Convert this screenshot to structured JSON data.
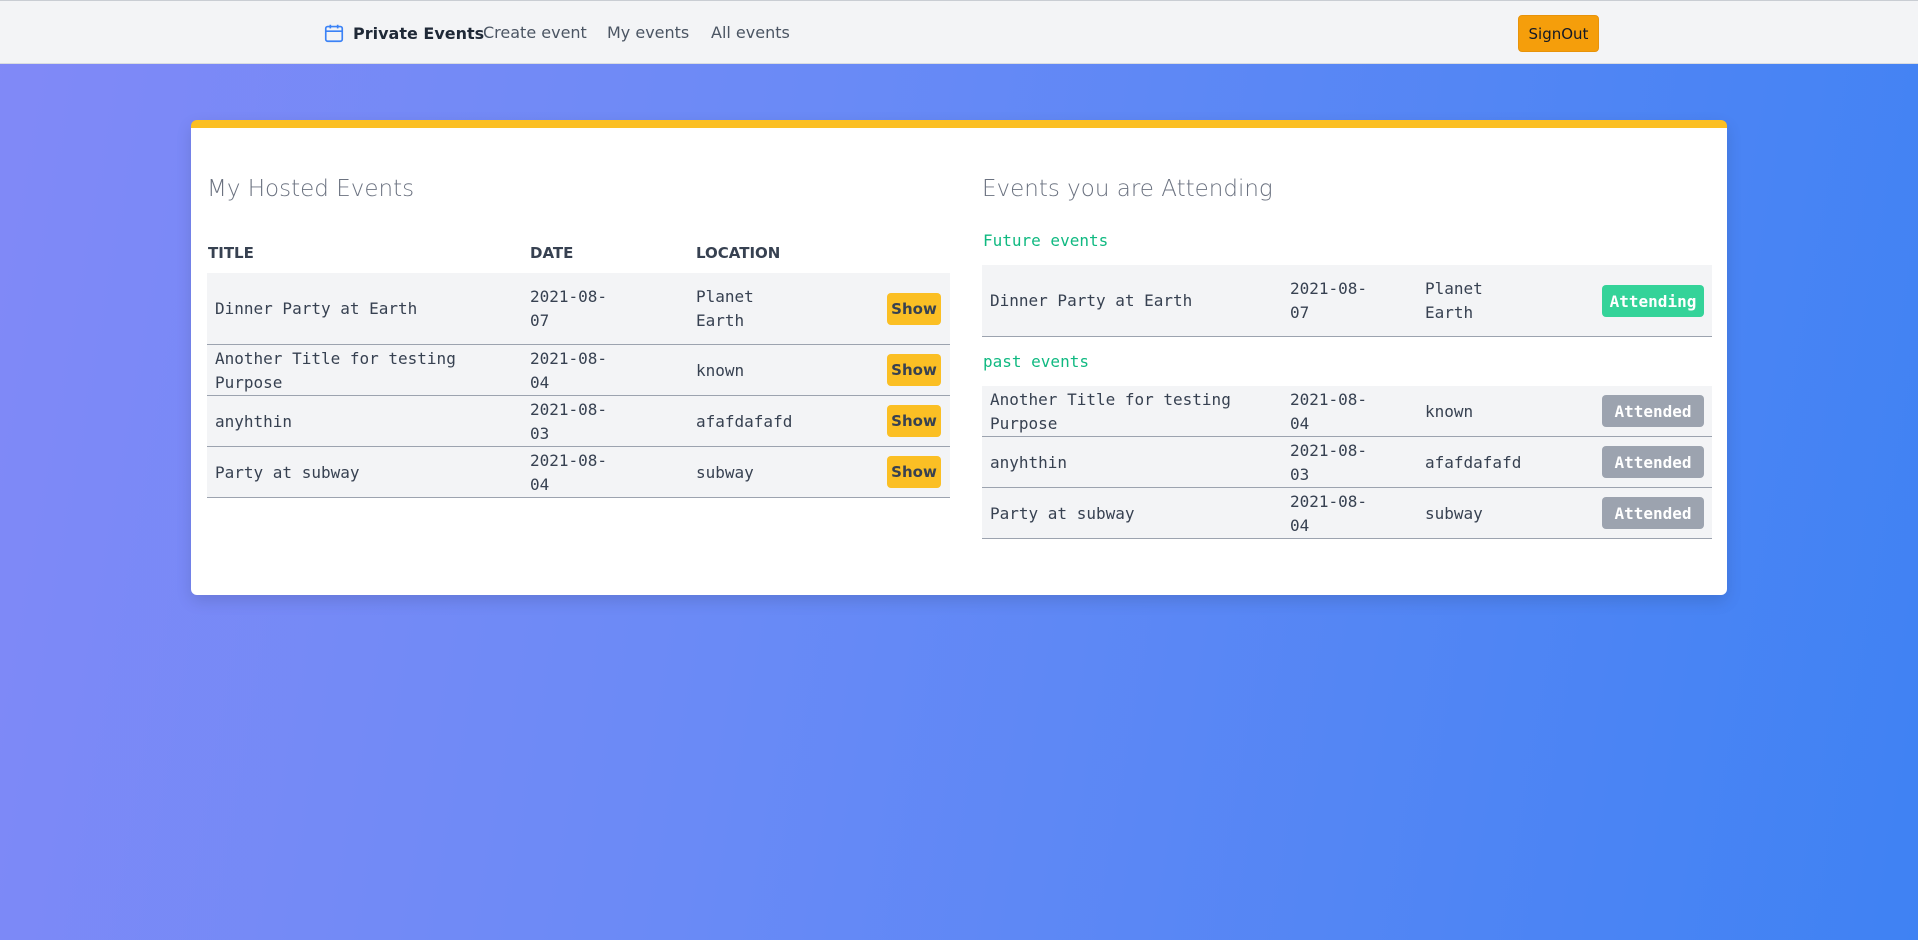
{
  "navbar": {
    "brand": "Private Events",
    "brand_icon": "calendar-icon",
    "links": [
      "Create event",
      "My events",
      "All events"
    ],
    "signout_label": "SignOut"
  },
  "hosted": {
    "title": "My Hosted Events",
    "columns": [
      "TITLE",
      "DATE",
      "LOCATION"
    ],
    "rows": [
      {
        "title": "Dinner Party at Earth",
        "date": "2021-08-07",
        "location": "Planet Earth",
        "action": "Show"
      },
      {
        "title": "Another Title for testing Purpose",
        "date": "2021-08-04",
        "location": "known",
        "action": "Show"
      },
      {
        "title": "anyhthin",
        "date": "2021-08-03",
        "location": "afafdafafd",
        "action": "Show"
      },
      {
        "title": "Party at subway",
        "date": "2021-08-04",
        "location": "subway",
        "action": "Show"
      }
    ]
  },
  "attending": {
    "title": "Events you are Attending",
    "future_label": "Future events",
    "past_label": "past events",
    "future": [
      {
        "title": "Dinner Party at Earth",
        "date": "2021-08-07",
        "location": "Planet Earth",
        "status": "Attending"
      }
    ],
    "past": [
      {
        "title": "Another Title for testing Purpose",
        "date": "2021-08-04",
        "location": "known",
        "status": "Attended"
      },
      {
        "title": "anyhthin",
        "date": "2021-08-03",
        "location": "afafdafafd",
        "status": "Attended"
      },
      {
        "title": "Party at subway",
        "date": "2021-08-04",
        "location": "subway",
        "status": "Attended"
      }
    ]
  },
  "colors": {
    "accent_yellow": "#fbbf24",
    "signout_orange": "#f59e0b",
    "attending_green": "#34d399",
    "attended_gray": "#9ca3af",
    "label_green": "#10b981"
  }
}
